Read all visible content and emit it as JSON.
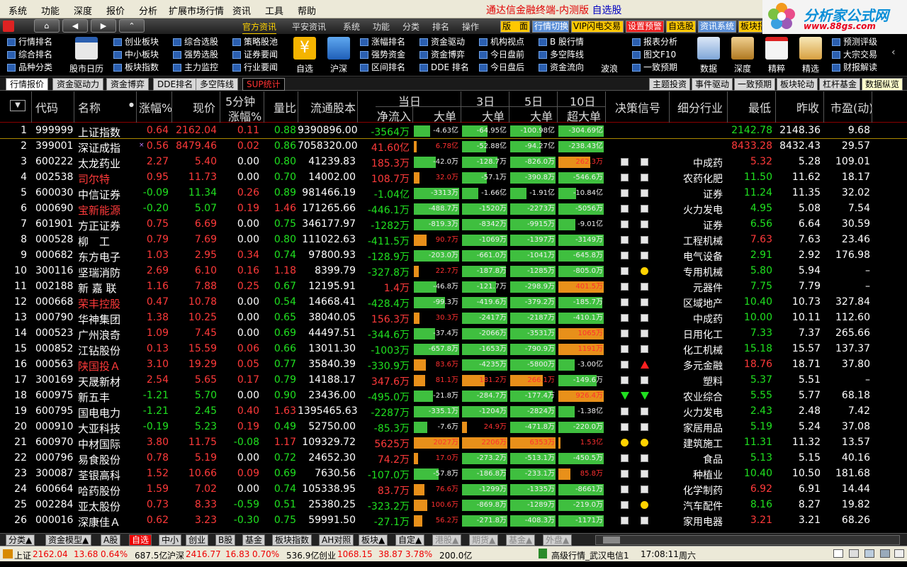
{
  "menu": [
    "系统",
    "功能",
    "深度",
    "报价",
    "分析",
    "扩展市场行情",
    "资讯",
    "工具",
    "帮助"
  ],
  "app_title": "通达信金融终端-内测版",
  "app_title_view": "自选股",
  "logo": {
    "text": "分析家公式网",
    "url": "www.88gs.com"
  },
  "toolbar": {
    "tabs": [
      "官方资讯",
      "平安资讯",
      "系统",
      "功能",
      "分类",
      "排名",
      "操作"
    ],
    "buttons": [
      "版　面",
      "行情切换",
      "VIP闪电交易",
      "设置预警",
      "自选股",
      "资讯系统",
      "板块指"
    ]
  },
  "ribbon": {
    "col1": [
      "行情排名",
      "综合排名",
      "品种分类"
    ],
    "b1": "股市日历",
    "col2": [
      "创业板块",
      "中小板块",
      "板块指数"
    ],
    "col3": [
      "综合选股",
      "强势选股",
      "主力监控"
    ],
    "col4": [
      "策略股池",
      "证券要闻",
      "行业要闻"
    ],
    "b2": "自选",
    "b3": "沪深",
    "col5": [
      "涨幅排名",
      "强势资金",
      "区间排名"
    ],
    "col6": [
      "资金驱动",
      "资金博弈",
      "DDE 排名"
    ],
    "col7": [
      "机构视点",
      "今日盘前",
      "今日盘后"
    ],
    "col8": [
      "B 股行情",
      "多空阵线",
      "资金流向"
    ],
    "b4": "波浪",
    "col9": [
      "报表分析",
      "图文F10",
      "一致预期"
    ],
    "bigs": [
      "数据",
      "深度",
      "精粹",
      "精选"
    ],
    "col10": [
      "预测评级",
      "大宗交易",
      "财报解读"
    ]
  },
  "view_tabs": [
    "行情报价",
    "资金驱动力",
    "资金博弈",
    "DDE排名",
    "多空阵线",
    "SUP统计"
  ],
  "right_tabs": [
    "主题投资",
    "事件驱动",
    "一致预期",
    "板块轮动",
    "杠杆基金",
    "数据纵览"
  ],
  "header": {
    "code": "代码",
    "name": "名称",
    "chg": "涨幅%",
    "price": "现价",
    "min5_top": "5分钟",
    "min5_bot": "涨幅%",
    "vr": "量比",
    "float": "流通股本",
    "today": "当日",
    "netin": "净流入",
    "big": "大单",
    "d3": "3日",
    "d5": "5日",
    "d10": "10日",
    "superbig": "超大单",
    "signal": "决策信号",
    "industry": "细分行业",
    "low": "最低",
    "prev": "昨收",
    "pe": "市盈(动)"
  },
  "rows": [
    {
      "n": "1",
      "code": "999999",
      "name": "上证指数",
      "chg": "0.64",
      "price": "2162.04",
      "m5": "0.11",
      "vr": "0.88",
      "flt": "9390896.00",
      "net": "-3564万",
      "b1": "-4.63亿",
      "b3": "-64.95亿",
      "b5": "-100.98亿",
      "b10": "-304.69亿",
      "s1": "",
      "s2": "",
      "ind": "",
      "low": "2142.78",
      "prev": "2148.36",
      "pe": "9.68"
    },
    {
      "n": "2",
      "code": "399001",
      "name": "深证成指",
      "chg": "0.56",
      "price": "8479.46",
      "m5": "0.02",
      "vr": "0.86",
      "flt": "7058320.00",
      "net": "41.60亿",
      "b1": "6.78亿",
      "b3": "-52.88亿",
      "b5": "-94.27亿",
      "b10": "-238.43亿",
      "s1": "",
      "s2": "",
      "ind": "",
      "low": "8433.28",
      "prev": "8432.43",
      "pe": "29.57"
    },
    {
      "n": "3",
      "code": "600222",
      "name": "太龙药业",
      "chg": "2.27",
      "price": "5.40",
      "m5": "0.00",
      "vr": "0.80",
      "flt": "41239.83",
      "net": "185.3万",
      "b1": "-42.0万",
      "b3": "-128.7万",
      "b5": "-826.0万",
      "b10": "262.3万",
      "s1": "sq",
      "s2": "sq",
      "ind": "中成药",
      "low": "5.32",
      "prev": "5.28",
      "pe": "109.01"
    },
    {
      "n": "4",
      "code": "002538",
      "name": "司尔特",
      "chg": "0.95",
      "price": "11.73",
      "m5": "0.00",
      "vr": "0.70",
      "flt": "14002.00",
      "net": "108.7万",
      "b1": "32.0万",
      "b3": "-57.1万",
      "b5": "-390.8万",
      "b10": "-546.6万",
      "s1": "sq",
      "s2": "sq",
      "ind": "农药化肥",
      "low": "11.50",
      "prev": "11.62",
      "pe": "18.17"
    },
    {
      "n": "5",
      "code": "600030",
      "name": "中信证券",
      "chg": "-0.09",
      "price": "11.34",
      "m5": "0.26",
      "vr": "0.89",
      "flt": "981466.19",
      "net": "-1.04亿",
      "b1": "-3313万",
      "b3": "-1.66亿",
      "b5": "-1.91亿",
      "b10": "-10.84亿",
      "s1": "sq",
      "s2": "sq",
      "ind": "证券",
      "low": "11.24",
      "prev": "11.35",
      "pe": "32.02"
    },
    {
      "n": "6",
      "code": "000690",
      "name": "宝新能源",
      "chg": "-0.20",
      "price": "5.07",
      "m5": "0.19",
      "vr": "1.46",
      "flt": "171265.66",
      "net": "-446.1万",
      "b1": "-488.7万",
      "b3": "-1520万",
      "b5": "-2273万",
      "b10": "-5056万",
      "s1": "sq",
      "s2": "sq",
      "ind": "火力发电",
      "low": "4.95",
      "prev": "5.08",
      "pe": "7.54"
    },
    {
      "n": "7",
      "code": "601901",
      "name": "方正证券",
      "chg": "0.75",
      "price": "6.69",
      "m5": "0.00",
      "vr": "0.75",
      "flt": "346177.97",
      "net": "-1282万",
      "b1": "-819.3万",
      "b3": "-8342万",
      "b5": "-9915万",
      "b10": "-9.01亿",
      "s1": "sq",
      "s2": "sq",
      "ind": "证券",
      "low": "6.56",
      "prev": "6.64",
      "pe": "30.59"
    },
    {
      "n": "8",
      "code": "000528",
      "name": "柳　工",
      "chg": "0.79",
      "price": "7.69",
      "m5": "0.00",
      "vr": "0.80",
      "flt": "111022.63",
      "net": "-411.5万",
      "b1": "90.7万",
      "b3": "-1069万",
      "b5": "-1397万",
      "b10": "-3149万",
      "s1": "sq",
      "s2": "sq",
      "ind": "工程机械",
      "low": "7.63",
      "prev": "7.63",
      "pe": "23.46"
    },
    {
      "n": "9",
      "code": "000682",
      "name": "东方电子",
      "chg": "1.03",
      "price": "2.95",
      "m5": "0.34",
      "vr": "0.74",
      "flt": "97800.93",
      "net": "-128.9万",
      "b1": "-203.0万",
      "b3": "-661.0万",
      "b5": "-1041万",
      "b10": "-645.8万",
      "s1": "sq",
      "s2": "sq",
      "ind": "电气设备",
      "low": "2.91",
      "prev": "2.92",
      "pe": "176.98"
    },
    {
      "n": "10",
      "code": "300116",
      "name": "坚瑞消防",
      "chg": "2.69",
      "price": "6.10",
      "m5": "0.16",
      "vr": "1.18",
      "flt": "8399.79",
      "net": "-327.8万",
      "b1": "22.7万",
      "b3": "-187.8万",
      "b5": "-1285万",
      "b10": "-805.0万",
      "s1": "sq",
      "s2": "dot",
      "ind": "专用机械",
      "low": "5.80",
      "prev": "5.94",
      "pe": "–"
    },
    {
      "n": "11",
      "code": "002188",
      "name": "新 嘉 联",
      "chg": "1.16",
      "price": "7.88",
      "m5": "0.25",
      "vr": "0.67",
      "flt": "12195.91",
      "net": "1.4万",
      "b1": "-46.8万",
      "b3": "-121.7万",
      "b5": "-298.9万",
      "b10": "401.5万",
      "s1": "sq",
      "s2": "sq",
      "ind": "元器件",
      "low": "7.75",
      "prev": "7.79",
      "pe": "–"
    },
    {
      "n": "12",
      "code": "000668",
      "name": "荣丰控股",
      "chg": "0.47",
      "price": "10.78",
      "m5": "0.00",
      "vr": "0.54",
      "flt": "14668.41",
      "net": "-428.4万",
      "b1": "-99.3万",
      "b3": "-419.6万",
      "b5": "-379.2万",
      "b10": "-185.7万",
      "s1": "sq",
      "s2": "sq",
      "ind": "区域地产",
      "low": "10.40",
      "prev": "10.73",
      "pe": "327.84"
    },
    {
      "n": "13",
      "code": "000790",
      "name": "华神集团",
      "chg": "1.38",
      "price": "10.25",
      "m5": "0.00",
      "vr": "0.65",
      "flt": "38040.05",
      "net": "156.3万",
      "b1": "30.3万",
      "b3": "-2417万",
      "b5": "-2187万",
      "b10": "-410.1万",
      "s1": "sq",
      "s2": "sq",
      "ind": "中成药",
      "low": "10.00",
      "prev": "10.11",
      "pe": "112.60"
    },
    {
      "n": "14",
      "code": "000523",
      "name": "广州浪奇",
      "chg": "1.09",
      "price": "7.45",
      "m5": "0.00",
      "vr": "0.69",
      "flt": "44497.51",
      "net": "-344.6万",
      "b1": "-37.4万",
      "b3": "-2066万",
      "b5": "-3531万",
      "b10": "1065万",
      "s1": "sq",
      "s2": "sq",
      "ind": "日用化工",
      "low": "7.33",
      "prev": "7.37",
      "pe": "265.66"
    },
    {
      "n": "15",
      "code": "000852",
      "name": "江钻股份",
      "chg": "0.13",
      "price": "15.59",
      "m5": "0.06",
      "vr": "0.66",
      "flt": "13011.30",
      "net": "-1003万",
      "b1": "-657.8万",
      "b3": "-1653万",
      "b5": "-790.9万",
      "b10": "1191万",
      "s1": "sq",
      "s2": "sq",
      "ind": "化工机械",
      "low": "15.18",
      "prev": "15.57",
      "pe": "137.37"
    },
    {
      "n": "16",
      "code": "000563",
      "name": "陕国投Ａ",
      "chg": "3.10",
      "price": "19.29",
      "m5": "0.05",
      "vr": "0.77",
      "flt": "35840.39",
      "net": "-330.9万",
      "b1": "83.6万",
      "b3": "-4235万",
      "b5": "-5800万",
      "b10": "-3.00亿",
      "s1": "sq",
      "s2": "up",
      "ind": "多元金融",
      "low": "18.76",
      "prev": "18.71",
      "pe": "37.80"
    },
    {
      "n": "17",
      "code": "300169",
      "name": "天晟新材",
      "chg": "2.54",
      "price": "5.65",
      "m5": "0.17",
      "vr": "0.79",
      "flt": "14188.17",
      "net": "347.6万",
      "b1": "81.1万",
      "b3": "181.2万",
      "b5": "266.1万",
      "b10": "-149.6万",
      "s1": "sq",
      "s2": "sq",
      "ind": "塑料",
      "low": "5.37",
      "prev": "5.51",
      "pe": "–"
    },
    {
      "n": "18",
      "code": "600975",
      "name": "新五丰",
      "chg": "-1.21",
      "price": "5.70",
      "m5": "0.00",
      "vr": "0.90",
      "flt": "23436.00",
      "net": "-495.0万",
      "b1": "-21.8万",
      "b3": "-284.7万",
      "b5": "-177.4万",
      "b10": "926.4万",
      "s1": "dn",
      "s2": "dn",
      "ind": "农业综合",
      "low": "5.55",
      "prev": "5.77",
      "pe": "68.18"
    },
    {
      "n": "19",
      "code": "600795",
      "name": "国电电力",
      "chg": "-1.21",
      "price": "2.45",
      "m5": "0.40",
      "vr": "1.63",
      "flt": "1395465.63",
      "net": "-2287万",
      "b1": "-335.1万",
      "b3": "-1204万",
      "b5": "-2824万",
      "b10": "-1.38亿",
      "s1": "sq",
      "s2": "sq",
      "ind": "火力发电",
      "low": "2.43",
      "prev": "2.48",
      "pe": "7.42"
    },
    {
      "n": "20",
      "code": "000910",
      "name": "大亚科技",
      "chg": "-0.19",
      "price": "5.23",
      "m5": "0.19",
      "vr": "0.49",
      "flt": "52750.00",
      "net": "-85.3万",
      "b1": "-7.6万",
      "b3": "24.9万",
      "b5": "-471.8万",
      "b10": "-220.0万",
      "s1": "sq",
      "s2": "sq",
      "ind": "家居用品",
      "low": "5.19",
      "prev": "5.24",
      "pe": "37.08"
    },
    {
      "n": "21",
      "code": "600970",
      "name": "中材国际",
      "chg": "3.80",
      "price": "11.75",
      "m5": "-0.08",
      "vr": "1.17",
      "flt": "109329.72",
      "net": "5625万",
      "b1": "2027万",
      "b3": "2206万",
      "b5": "6353万",
      "b10": "1.53亿",
      "s1": "dot",
      "s2": "dot",
      "ind": "建筑施工",
      "low": "11.31",
      "prev": "11.32",
      "pe": "13.57"
    },
    {
      "n": "22",
      "code": "000796",
      "name": "易食股份",
      "chg": "0.78",
      "price": "5.19",
      "m5": "0.00",
      "vr": "0.72",
      "flt": "24652.30",
      "net": "74.2万",
      "b1": "17.0万",
      "b3": "-273.2万",
      "b5": "-513.1万",
      "b10": "-450.5万",
      "s1": "sq",
      "s2": "sq",
      "ind": "食品",
      "low": "5.13",
      "prev": "5.15",
      "pe": "40.16"
    },
    {
      "n": "23",
      "code": "300087",
      "name": "荃银高科",
      "chg": "1.52",
      "price": "10.66",
      "m5": "0.09",
      "vr": "0.69",
      "flt": "7630.56",
      "net": "-107.0万",
      "b1": "-57.8万",
      "b3": "-186.8万",
      "b5": "-233.1万",
      "b10": "85.8万",
      "s1": "sq",
      "s2": "sq",
      "ind": "种植业",
      "low": "10.40",
      "prev": "10.50",
      "pe": "181.68"
    },
    {
      "n": "24",
      "code": "600664",
      "name": "哈药股份",
      "chg": "1.59",
      "price": "7.02",
      "m5": "0.00",
      "vr": "0.74",
      "flt": "105338.95",
      "net": "83.7万",
      "b1": "76.6万",
      "b3": "-1299万",
      "b5": "-1335万",
      "b10": "-8661万",
      "s1": "sq",
      "s2": "sq",
      "ind": "化学制药",
      "low": "6.92",
      "prev": "6.91",
      "pe": "14.44"
    },
    {
      "n": "25",
      "code": "002284",
      "name": "亚太股份",
      "chg": "0.73",
      "price": "8.33",
      "m5": "-0.59",
      "vr": "0.51",
      "flt": "25380.25",
      "net": "-323.2万",
      "b1": "100.6万",
      "b3": "-869.8万",
      "b5": "-1289万",
      "b10": "-219.0万",
      "s1": "sq",
      "s2": "dot",
      "ind": "汽车配件",
      "low": "8.16",
      "prev": "8.27",
      "pe": "19.82"
    },
    {
      "n": "26",
      "code": "000016",
      "name": "深康佳Ａ",
      "chg": "0.62",
      "price": "3.23",
      "m5": "-0.30",
      "vr": "0.75",
      "flt": "59991.50",
      "net": "-27.1万",
      "b1": "56.2万",
      "b3": "-271.8万",
      "b5": "-408.3万",
      "b10": "-1171万",
      "s1": "sq",
      "s2": "sq",
      "ind": "家用电器",
      "low": "3.21",
      "prev": "3.21",
      "pe": "68.26"
    }
  ],
  "bottom_tabs": [
    "分类▲",
    "资金模型▲",
    "A股",
    "自选",
    "中小",
    "创业",
    "B股",
    "基金",
    "板块指数",
    "AH对照",
    "板块▲",
    "自定▲",
    "港股▲",
    "期货▲",
    "基金▲",
    "外盘▲"
  ],
  "status": {
    "sh_label": "上证",
    "sh_val": "2162.04",
    "sh_chg": "13.68",
    "sh_pct": "0.64%",
    "sh_amt": "687.5亿",
    "sz_label": "沪深",
    "sz_val": "2416.77",
    "sz_chg": "16.83",
    "sz_pct": "0.70%",
    "sz_amt": "536.9亿",
    "cy_label": "创业",
    "cy_val": "1068.15",
    "cy_chg": "38.87",
    "cy_pct": "3.78%",
    "cy_amt": "200.0亿",
    "server": "高级行情_武汉电信1",
    "time": "17:08:11",
    "weekday": "周六"
  }
}
